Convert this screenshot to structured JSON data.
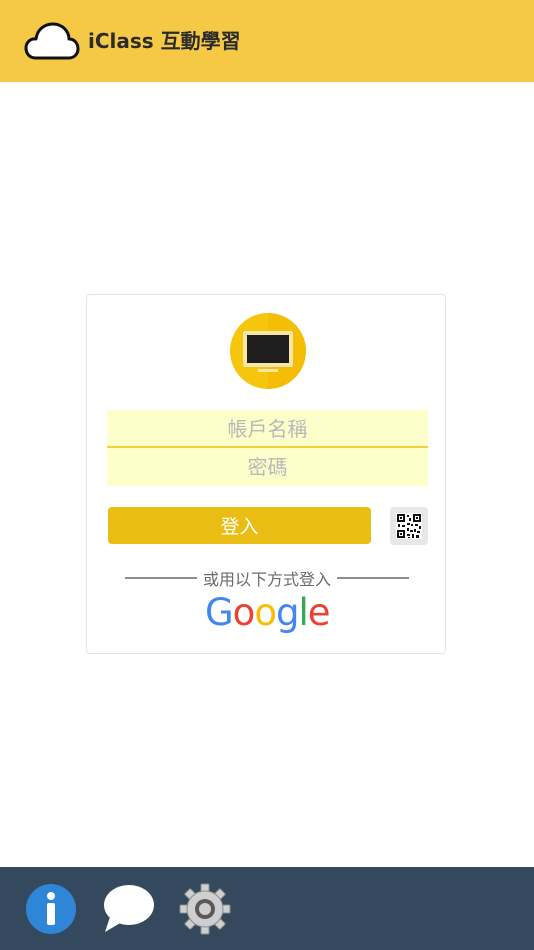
{
  "header": {
    "title": "iClass 互動學習",
    "logo_icon": "cloud-icon",
    "background_color": "#f5c945"
  },
  "login": {
    "logo_icon": "monitor-icon",
    "account_placeholder": "帳戶名稱",
    "password_placeholder": "密碼",
    "login_label": "登入",
    "qr_icon": "qr-code-icon",
    "alt_login_text": "或用以下方式登入",
    "google": {
      "letters": [
        "G",
        "o",
        "o",
        "g",
        "l",
        "e"
      ],
      "colors": [
        "#4285f4",
        "#ea4335",
        "#fbbc05",
        "#4285f4",
        "#34a853",
        "#ea4335"
      ]
    },
    "accent_color": "#e9bd13",
    "field_color": "#fcffc9"
  },
  "footer": {
    "background_color": "#34485e",
    "icons": [
      "info-icon",
      "chat-icon",
      "gear-icon"
    ]
  }
}
